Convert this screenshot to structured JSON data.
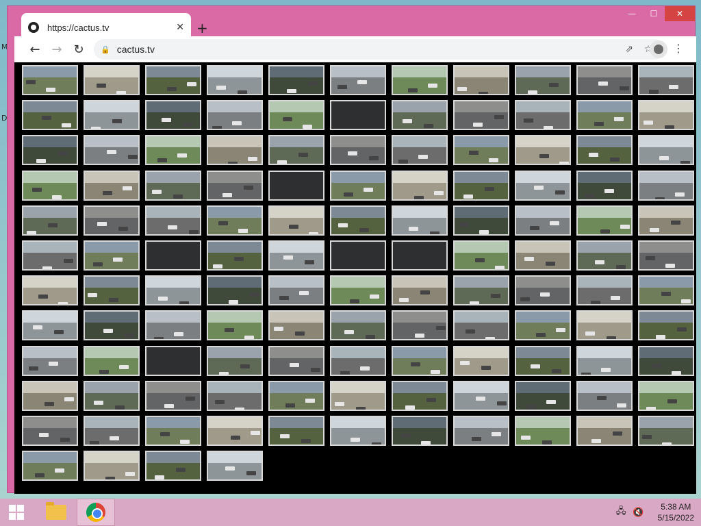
{
  "desktop": {
    "glyph_1": "M",
    "glyph_2": "D"
  },
  "window": {
    "controls": {
      "minimize": "—",
      "maximize": "☐",
      "close": "✕"
    }
  },
  "tab": {
    "title": "https://cactus.tv",
    "close_label": "✕",
    "new_tab_label": "+"
  },
  "toolbar": {
    "back_icon": "←",
    "forward_icon": "→",
    "reload_icon": "↻",
    "url": "cactus.tv",
    "share_icon": "⇗",
    "bookmark_icon": "☆",
    "menu_icon": "⋮"
  },
  "camera_grid": {
    "columns": 11,
    "count": 125,
    "offline_indices": [
      16,
      37,
      57,
      60,
      61,
      90
    ]
  },
  "taskbar": {
    "time": "5:38 AM",
    "date": "5/15/2022",
    "network_icon": "network-icon",
    "volume_icon": "volume-muted-icon"
  }
}
